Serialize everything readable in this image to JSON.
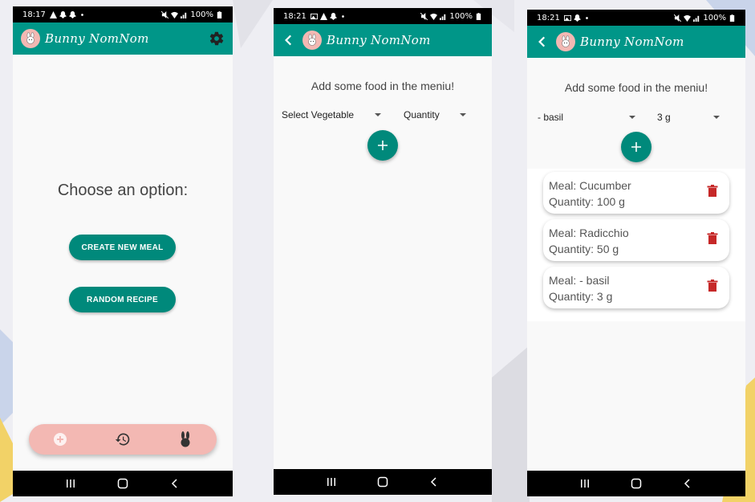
{
  "app": {
    "title": "Bunny NomNom"
  },
  "status": {
    "screen1_time": "18:17",
    "screen2_time": "18:21",
    "screen3_time": "18:21",
    "battery": "100%"
  },
  "home": {
    "heading": "Choose an option:",
    "create_label": "CREATE NEW MEAL",
    "random_label": "RANDOM RECIPE",
    "bottom_nav": [
      "add-icon",
      "history-icon",
      "bunny-icon"
    ]
  },
  "add_empty": {
    "hint": "Add some food in the meniu!",
    "vegetable_select": "Select Vegetable",
    "quantity_select": "Quantity"
  },
  "add_filled": {
    "hint": "Add some food in the meniu!",
    "vegetable_select": "- basil",
    "quantity_select": "3 g",
    "meals": [
      {
        "meal": "Meal: Cucumber",
        "quantity": "Quantity: 100 g"
      },
      {
        "meal": "Meal: Radicchio",
        "quantity": "Quantity: 50 g"
      },
      {
        "meal": "Meal:  - basil",
        "quantity": "Quantity: 3 g"
      }
    ]
  },
  "colors": {
    "teal": "#009688",
    "button_teal": "#00897b",
    "pink": "#f3b8b3",
    "delete_red": "#c62828"
  }
}
